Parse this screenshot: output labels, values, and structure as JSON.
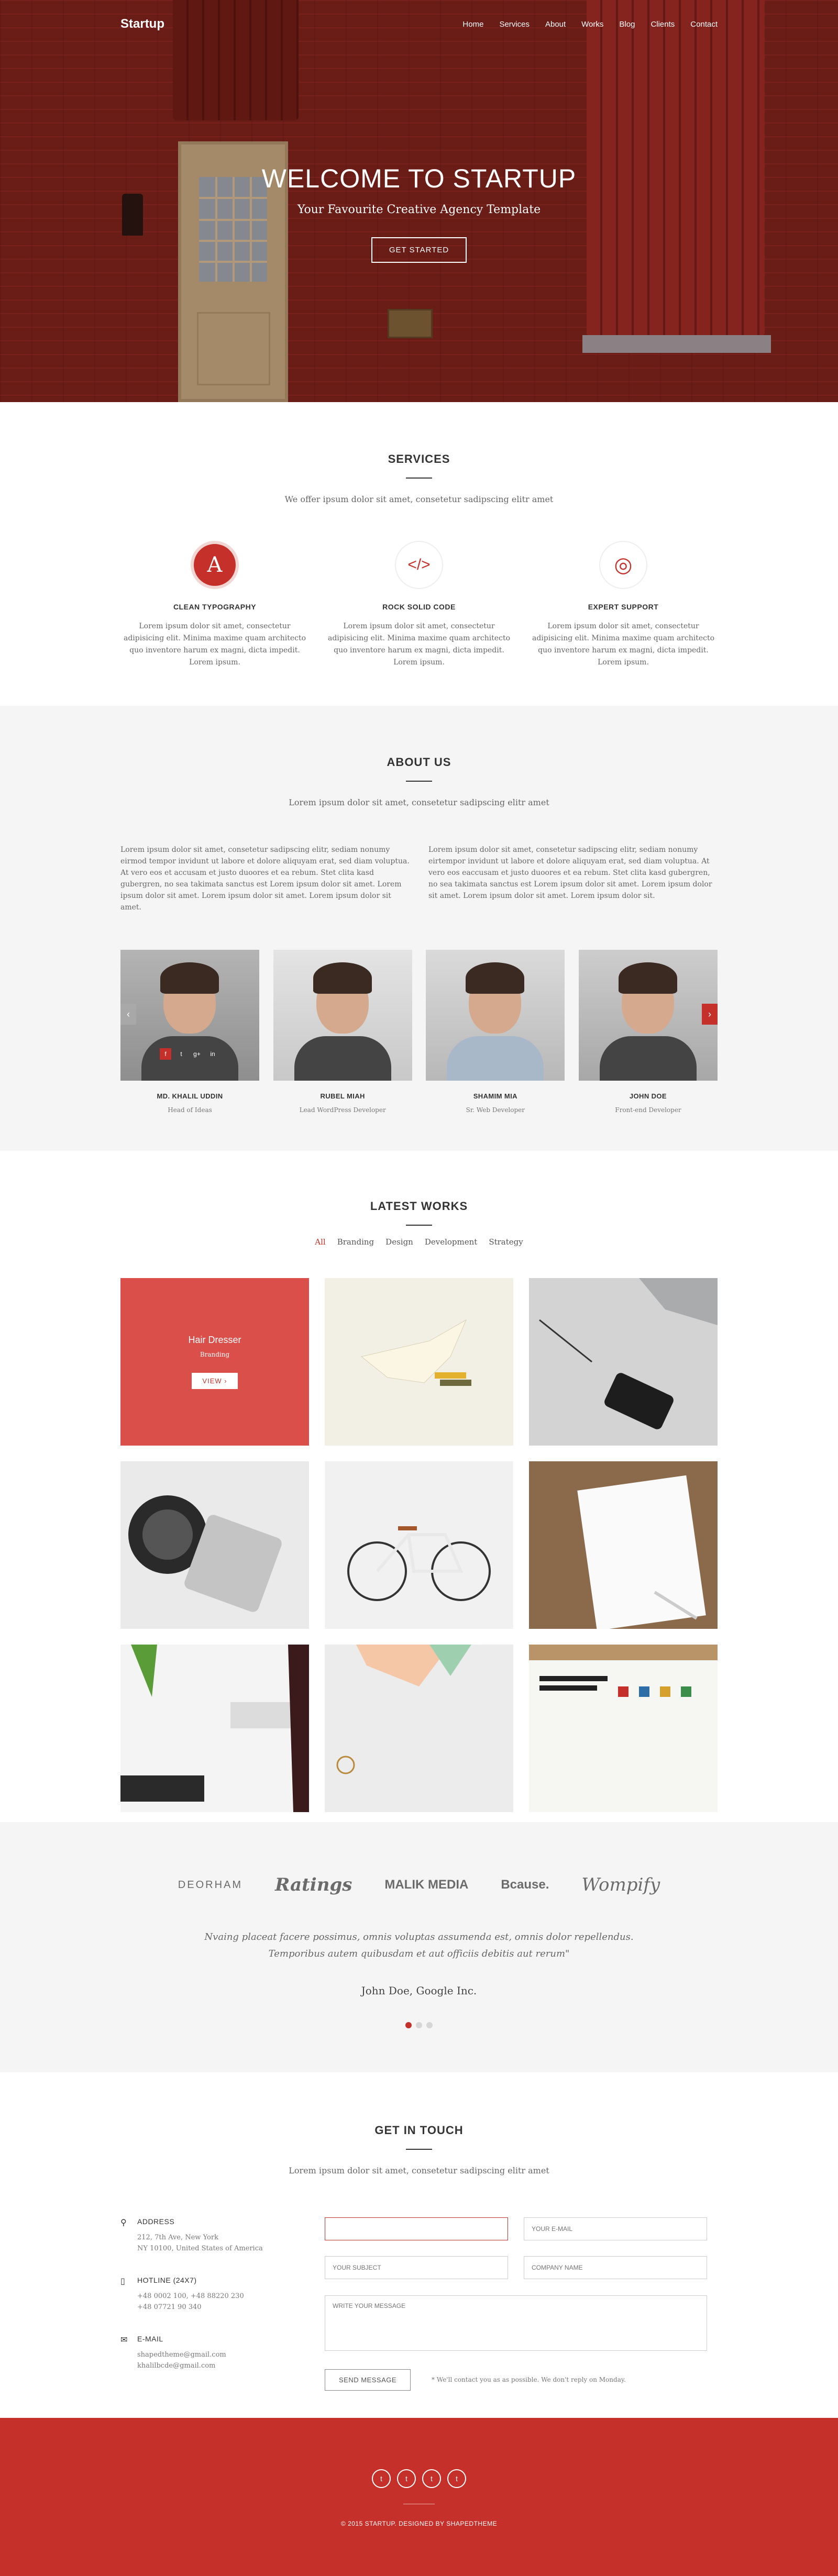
{
  "nav": {
    "logo": "Startup",
    "items": [
      "Home",
      "Services",
      "About",
      "Works",
      "Blog",
      "Clients",
      "Contact"
    ]
  },
  "hero": {
    "title": "WELCOME TO STARTUP",
    "subtitle": "Your Favourite Creative Agency Template",
    "cta": "GET STARTED"
  },
  "services": {
    "title": "SERVICES",
    "subtitle": "We offer ipsum dolor sit amet, consetetur sadipscing elitr amet",
    "items": [
      {
        "icon": "letter-a-icon",
        "glyph": "A",
        "title": "CLEAN TYPOGRAPHY",
        "text": "Lorem ipsum dolor sit amet, consectetur adipisicing elit. Minima maxime quam architecto quo inventore harum ex magni, dicta impedit. Lorem ipsum."
      },
      {
        "icon": "code-icon",
        "glyph": "</>",
        "title": "ROCK SOLID CODE",
        "text": "Lorem ipsum dolor sit amet, consectetur adipisicing elit. Minima maxime quam architecto quo inventore harum ex magni, dicta impedit. Lorem ipsum."
      },
      {
        "icon": "lifebuoy-icon",
        "glyph": "◎",
        "title": "EXPERT SUPPORT",
        "text": "Lorem ipsum dolor sit amet, consectetur adipisicing elit. Minima maxime quam architecto quo inventore harum ex magni, dicta impedit. Lorem ipsum."
      }
    ]
  },
  "about": {
    "title": "ABOUT US",
    "subtitle": "Lorem ipsum dolor sit amet, consetetur sadipscing elitr amet",
    "col1": "Lorem ipsum dolor sit amet, consetetur sadipscing elitr, sediam nonumy eirmod tempor invidunt ut labore et dolore aliquyam erat, sed diam voluptua. At vero eos et accusam et justo duoores et ea rebum. Stet clita kasd gubergren, no sea takimata sanctus est Lorem ipsum dolor sit amet. Lorem ipsum dolor sit amet. Lorem ipsum dolor sit amet. Lorem ipsum dolor sit amet.",
    "col2": "Lorem ipsum dolor sit amet, consetetur sadipscing elitr, sediam nonumy eirtempor invidunt ut labore et dolore aliquyam erat, sed diam voluptua. At vero eos eaccusam et justo duoores et ea rebum. Stet clita kasd gubergren, no sea takimata sanctus est Lorem ipsum dolor sit amet. Lorem ipsum dolor sit amet. Lorem ipsum dolor sit amet. Lorem ipsum dolor sit.",
    "team": [
      {
        "name": "MD. KHALIL UDDIN",
        "role": "Head of Ideas"
      },
      {
        "name": "RUBEL MIAH",
        "role": "Lead WordPress Developer"
      },
      {
        "name": "SHAMIM MIA",
        "role": "Sr. Web Developer"
      },
      {
        "name": "JOHN DOE",
        "role": "Front-end Developer"
      }
    ],
    "social": [
      "f",
      "t",
      "g+",
      "in"
    ],
    "prev": "‹",
    "next": "›"
  },
  "works": {
    "title": "LATEST WORKS",
    "filters": [
      "All",
      "Branding",
      "Design",
      "Development",
      "Strategy"
    ],
    "hover": {
      "title": "Hair Dresser",
      "category": "Branding",
      "view": "VIEW  ›"
    }
  },
  "clients": {
    "logos": [
      "DEORHAM",
      "Ratings",
      "MALIK MEDIA",
      "Bcause.",
      "Wompify"
    ],
    "quote_line1": "Nvaing placeat facere possimus, omnis voluptas assumenda est, omnis dolor repellendus.",
    "quote_line2": "Temporibus autem quibusdam et aut officiis debitis aut rerum\"",
    "author": "John Doe, Google Inc."
  },
  "contact": {
    "title": "GET IN TOUCH",
    "subtitle": "Lorem ipsum dolor sit amet, consetetur sadipscing elitr amet",
    "address_label": "ADDRESS",
    "address": "212, 7th Ave, New York\nNY 10100, United States of America",
    "hotline_label": "HOTLINE (24X7)",
    "hotline": "+48 0002 100, +48 88220 230\n+48 07721 90 340",
    "email_label": "E-MAIL",
    "email": "shapedtheme@gmail.com\nkhalilbcde@gmail.com",
    "name_ph": "",
    "email_ph": "YOUR E-MAIL",
    "subject_ph": "YOUR SUBJECT",
    "company_ph": "COMPANY NAME",
    "message_ph": "WRITE YOUR MESSAGE",
    "send": "SEND MESSAGE",
    "note": "* We'll contact you as as possible. We don't reply on Monday."
  },
  "footer": {
    "social": [
      "t",
      "t",
      "t",
      "t"
    ],
    "copyright": "© 2015 STARTUP. DESIGNED BY SHAPEDTHEME"
  }
}
